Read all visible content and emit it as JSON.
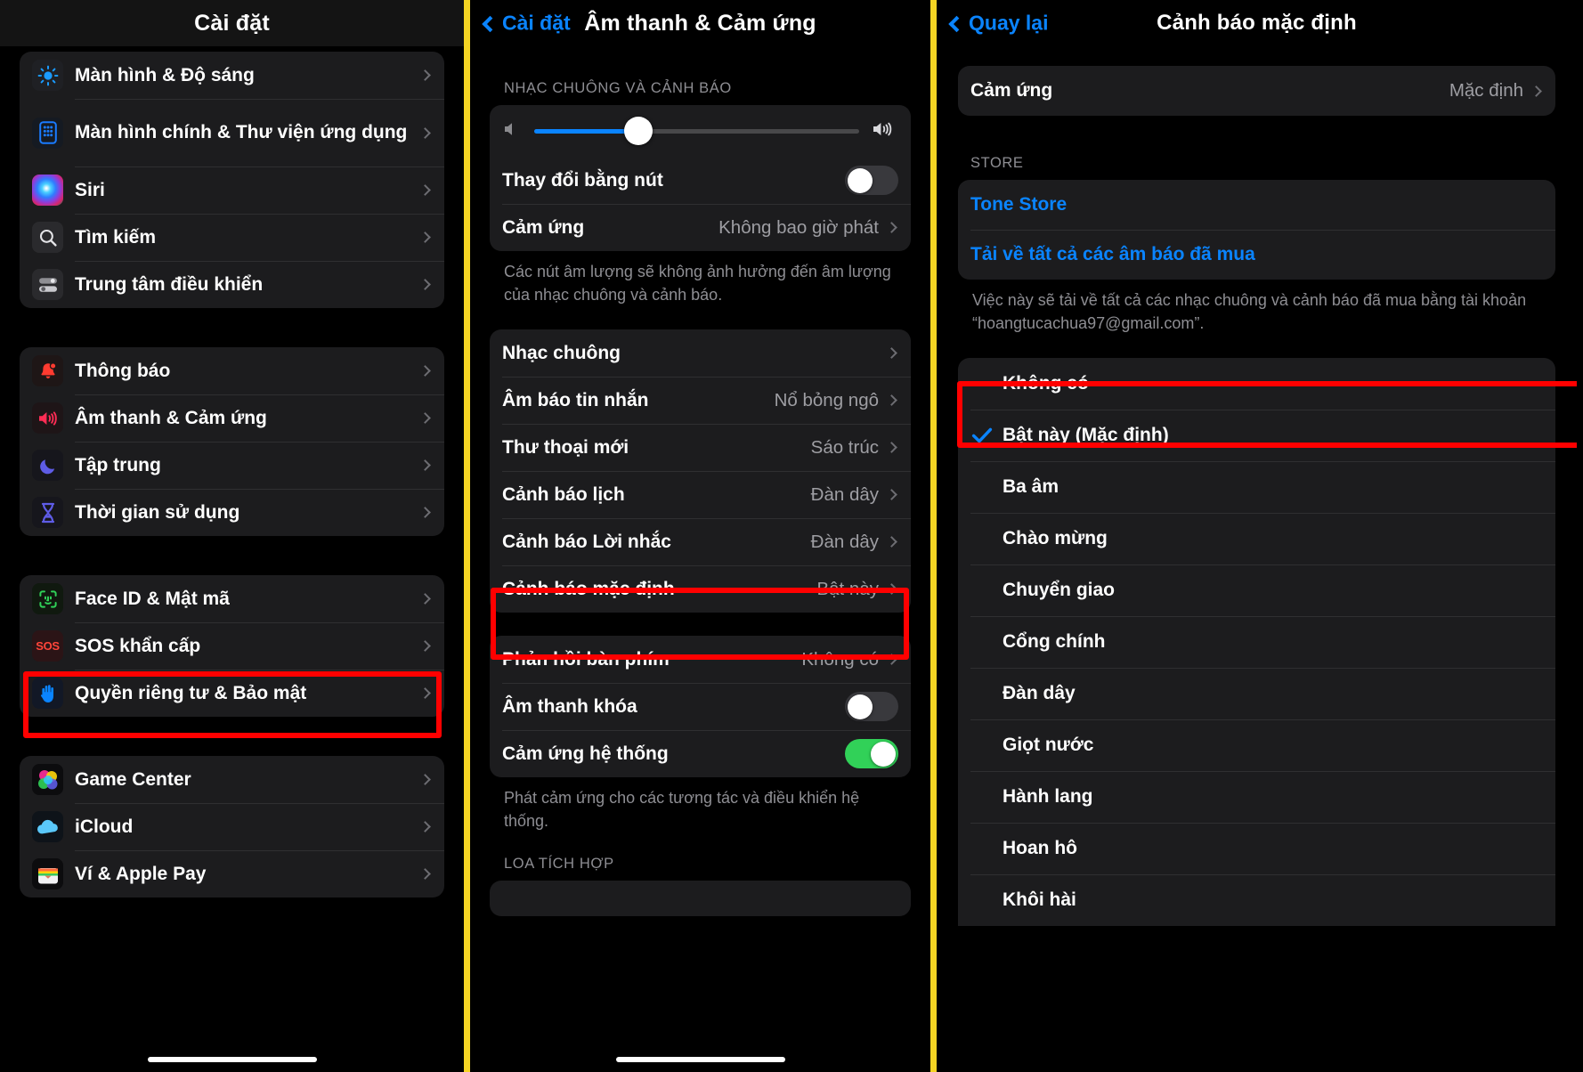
{
  "theme": {
    "accent_blue": "#0a84ff",
    "highlight_red": "#ff0000",
    "divider_yellow": "#f5d423",
    "toggle_green": "#31d158",
    "group_bg": "#1c1c1e",
    "page_bg": "#000000"
  },
  "panel1": {
    "title": "Cài đặt",
    "groups": [
      {
        "items": [
          {
            "label": "Màn hình & Độ sáng",
            "icon": "brightness-icon",
            "chevron": true
          },
          {
            "label": "Màn hình chính & Thư viện ứng dụng",
            "icon": "home-screen-icon",
            "chevron": true
          },
          {
            "label": "Siri",
            "icon": "siri-icon",
            "chevron": true
          },
          {
            "label": "Tìm kiếm",
            "icon": "search-icon",
            "chevron": true
          },
          {
            "label": "Trung tâm điều khiển",
            "icon": "control-center-icon",
            "chevron": true
          }
        ]
      },
      {
        "items": [
          {
            "label": "Thông báo",
            "icon": "notification-bell-icon",
            "chevron": true
          },
          {
            "label": "Âm thanh & Cảm ứng",
            "icon": "speaker-icon",
            "chevron": true
          },
          {
            "label": "Tập trung",
            "icon": "moon-icon",
            "chevron": true
          },
          {
            "label": "Thời gian sử dụng",
            "icon": "hourglass-icon",
            "chevron": true
          }
        ]
      },
      {
        "items": [
          {
            "label": "Face ID & Mật mã",
            "icon": "face-id-icon",
            "chevron": true
          },
          {
            "label": "SOS khẩn cấp",
            "icon": "sos-icon",
            "chevron": true
          },
          {
            "label": "Quyền riêng tư & Bảo mật",
            "icon": "privacy-hand-icon",
            "chevron": true,
            "highlighted": true
          }
        ]
      },
      {
        "items": [
          {
            "label": "Game Center",
            "icon": "game-center-icon",
            "chevron": true
          },
          {
            "label": "iCloud",
            "icon": "icloud-icon",
            "chevron": true
          },
          {
            "label": "Ví & Apple Pay",
            "icon": "wallet-icon",
            "chevron": true
          }
        ]
      }
    ]
  },
  "panel2": {
    "back_label": "Cài đặt",
    "title": "Âm thanh & Cảm ứng",
    "section1_header": "NHẠC CHUÔNG VÀ CẢNH BÁO",
    "volume": {
      "level_percent": 32,
      "low_icon": "speaker-low-icon",
      "high_icon": "speaker-high-icon"
    },
    "group1": [
      {
        "label": "Thay đổi bằng nút",
        "type": "toggle",
        "on": false
      },
      {
        "label": "Cảm ứng",
        "type": "value",
        "value": "Không bao giờ phát",
        "chevron": true
      }
    ],
    "footnote1": "Các nút âm lượng sẽ không ảnh hưởng đến âm lượng của nhạc chuông và cảnh báo.",
    "group2": [
      {
        "label": "Nhạc chuông",
        "type": "value",
        "value": "",
        "chevron": true
      },
      {
        "label": "Âm báo tin nhắn",
        "type": "value",
        "value": "Nổ bỏng ngô",
        "chevron": true
      },
      {
        "label": "Thư thoại mới",
        "type": "value",
        "value": "Sáo trúc",
        "chevron": true
      },
      {
        "label": "Cảnh báo lịch",
        "type": "value",
        "value": "Đàn dây",
        "chevron": true
      },
      {
        "label": "Cảnh báo Lời nhắc",
        "type": "value",
        "value": "Đàn dây",
        "chevron": true
      },
      {
        "label": "Cảnh báo mặc định",
        "type": "value",
        "value": "Bật này",
        "chevron": true,
        "highlighted": true
      }
    ],
    "group3": [
      {
        "label": "Phản hồi bàn phím",
        "type": "value",
        "value": "Không có",
        "chevron": true
      },
      {
        "label": "Âm thanh khóa",
        "type": "toggle",
        "on": false
      },
      {
        "label": "Cảm ứng hệ thống",
        "type": "toggle",
        "on": true
      }
    ],
    "footnote2": "Phát cảm ứng cho các tương tác và điều khiển hệ thống.",
    "section2_header": "LOA TÍCH HỢP"
  },
  "panel3": {
    "back_label": "Quay lại",
    "title": "Cảnh báo mặc định",
    "haptic_row": {
      "label": "Cảm ứng",
      "value": "Mặc định",
      "chevron": true
    },
    "store_header": "STORE",
    "store_links": [
      {
        "label": "Tone Store"
      },
      {
        "label": "Tải về tất cả các âm báo đã mua"
      }
    ],
    "store_footnote": "Việc này sẽ tải về tất cả các nhạc chuông và cảnh báo đã mua bằng tài khoản “hoangtucachua97@gmail.com”.",
    "tones": [
      {
        "label": "Không có",
        "selected": false,
        "highlighted": true
      },
      {
        "label": "Bật này (Mặc định)",
        "selected": true
      },
      {
        "label": "Ba âm",
        "selected": false
      },
      {
        "label": "Chào mừng",
        "selected": false
      },
      {
        "label": "Chuyển giao",
        "selected": false
      },
      {
        "label": "Cổng chính",
        "selected": false
      },
      {
        "label": "Đàn dây",
        "selected": false
      },
      {
        "label": "Giọt nước",
        "selected": false
      },
      {
        "label": "Hành lang",
        "selected": false
      },
      {
        "label": "Hoan hô",
        "selected": false
      },
      {
        "label": "Khôi hài",
        "selected": false
      }
    ]
  }
}
